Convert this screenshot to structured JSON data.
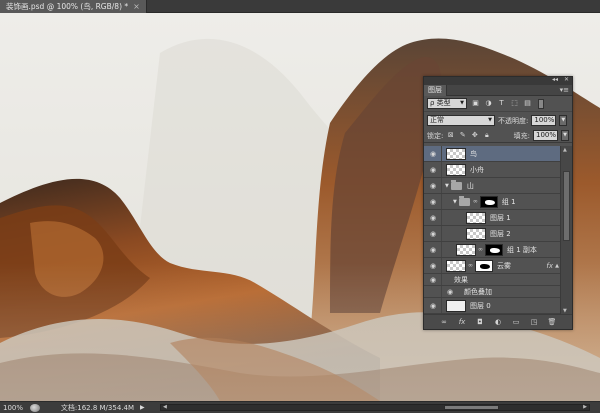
{
  "document": {
    "tab_title": "装饰画.psd @ 100% (鸟, RGB/8) *",
    "close_symbol": "×"
  },
  "status": {
    "zoom": "100%",
    "doc_info": "文档:162.8 M/354.4M",
    "arrow": "▶",
    "scroll_left": "◀",
    "scroll_right": "▶"
  },
  "panel": {
    "collapse_symbol": "◂◂",
    "close_symbol": "✕",
    "tab_label": "图层",
    "menu_symbol": "▾≡",
    "filter_kind": "ρ 类型",
    "filter_icons": [
      "image-filter-icon",
      "adjustment-filter-icon",
      "text-filter-icon",
      "shape-filter-icon",
      "smart-object-filter-icon"
    ],
    "blend_mode": "正常",
    "opacity_label": "不透明度:",
    "opacity_value": "100%",
    "lock_label": "锁定:",
    "fill_label": "填充:",
    "fill_value": "100%",
    "layers": [
      {
        "name": "鸟",
        "selected": true
      },
      {
        "name": "小舟"
      },
      {
        "name": "山",
        "type": "group"
      },
      {
        "name": "组 1",
        "type": "group"
      },
      {
        "name": "图层 1"
      },
      {
        "name": "图层 2"
      },
      {
        "name": "组 1 副本"
      },
      {
        "name": "云雾",
        "fx": "fx"
      },
      {
        "name": "效果"
      },
      {
        "name": "颜色叠加"
      },
      {
        "name": "图层 0"
      }
    ],
    "footer_icons": [
      "link-layers-icon",
      "fx-icon",
      "add-mask-icon",
      "adjustment-layer-icon",
      "new-group-icon",
      "new-layer-icon",
      "delete-layer-icon"
    ]
  },
  "colors": {
    "canvas_bg": "#ecebe7",
    "mountain_brown": "#a9531f",
    "mountain_dark": "#4a3225",
    "selection_blue": "#5e6b80"
  }
}
